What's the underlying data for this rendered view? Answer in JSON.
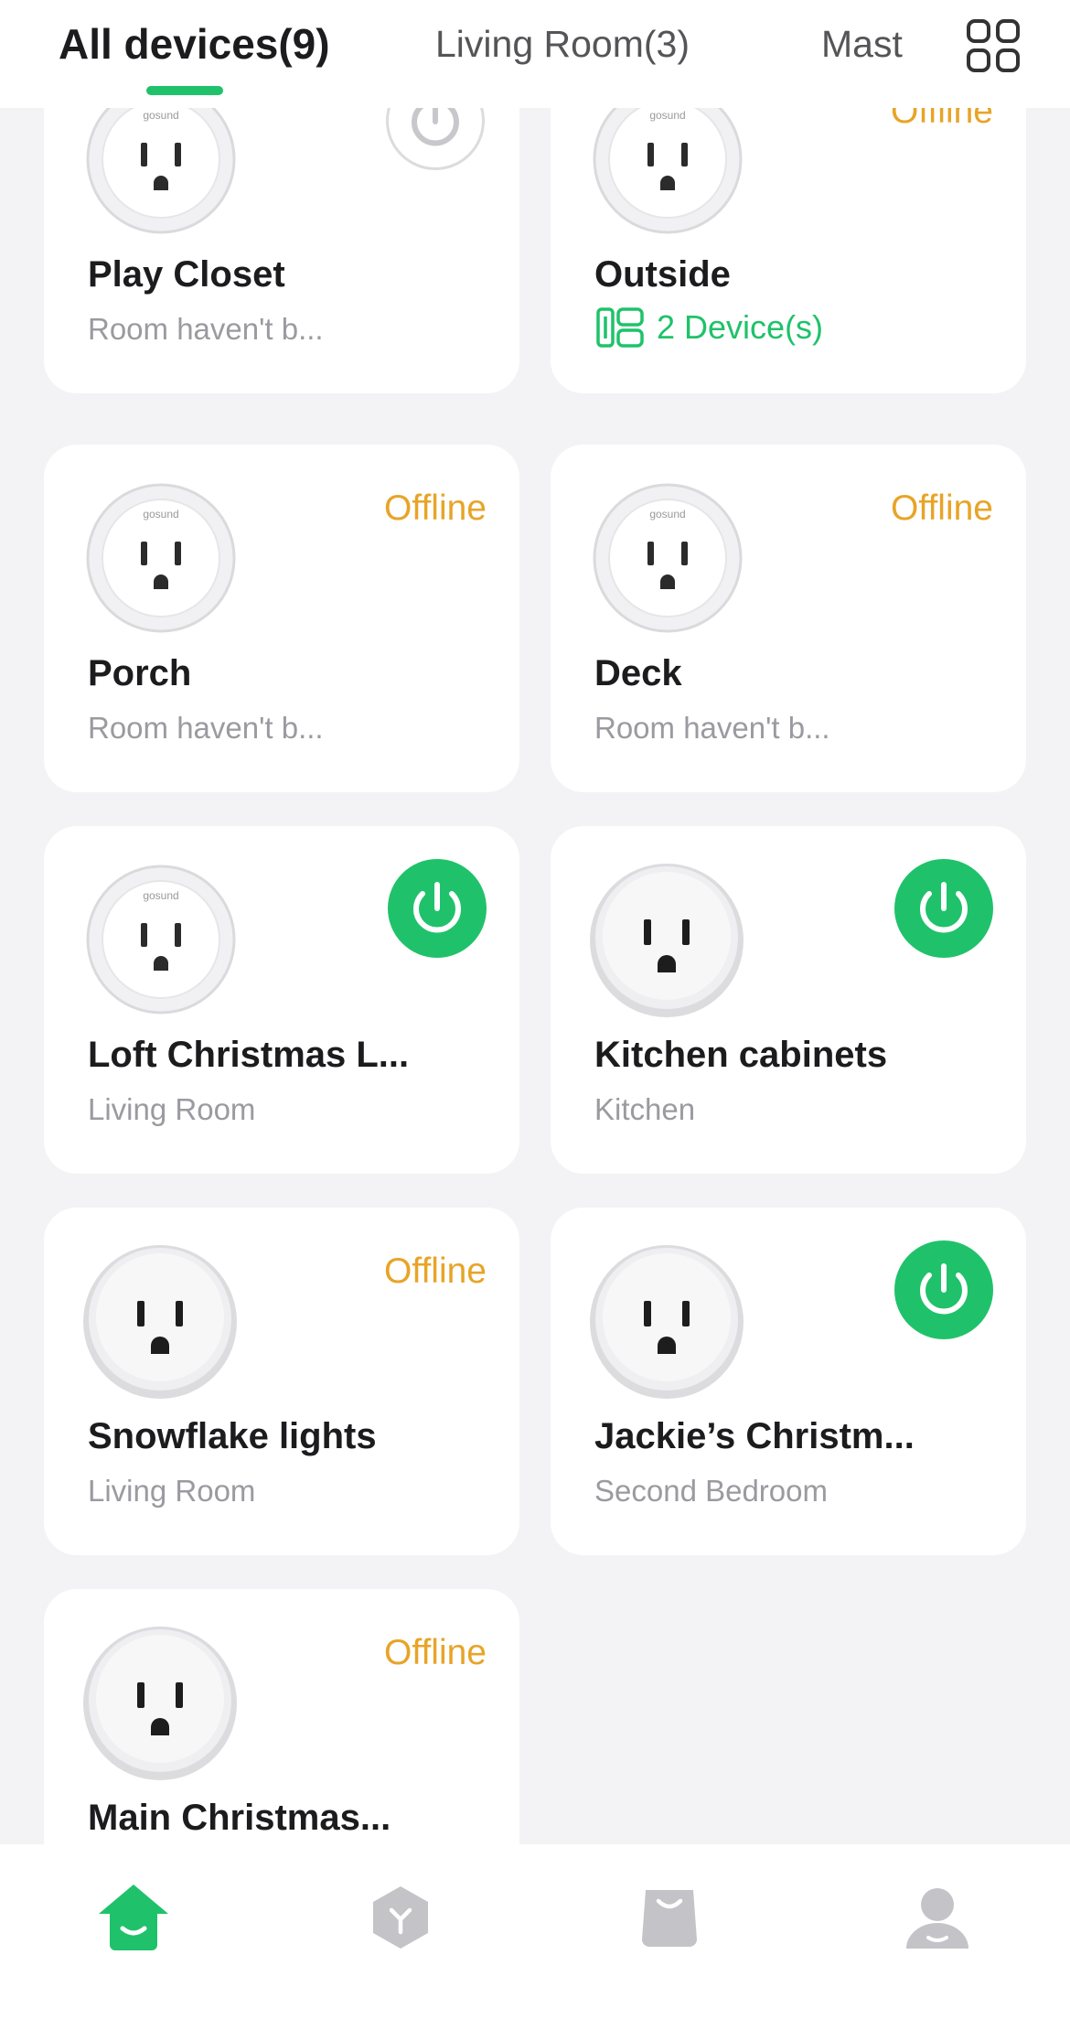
{
  "tabs": [
    {
      "label": "All devices(9)",
      "active": true
    },
    {
      "label": "Living Room(3)",
      "active": false
    },
    {
      "label": "Mast",
      "active": false
    }
  ],
  "colors": {
    "accent": "#1fc26a",
    "offline": "#e8a427",
    "card_bg": "#ffffff",
    "page_bg": "#f3f3f5",
    "subtitle": "#9a9aa0"
  },
  "devices": [
    {
      "name": "Play Closet",
      "subtitle": "Room haven't b...",
      "status": "power-off",
      "plug_icon": "gosund-plug-icon"
    },
    {
      "name": "Outside",
      "subtitle": "2 Device(s)",
      "status_text": "Offline",
      "status": "offline",
      "plug_icon": "gosund-plug-icon",
      "group_icon": "device-group-icon"
    },
    {
      "name": "Porch",
      "subtitle": "Room haven't b...",
      "status_text": "Offline",
      "status": "offline",
      "plug_icon": "gosund-plug-icon"
    },
    {
      "name": "Deck",
      "subtitle": "Room haven't b...",
      "status_text": "Offline",
      "status": "offline",
      "plug_icon": "gosund-plug-icon"
    },
    {
      "name": "Loft Christmas L...",
      "subtitle": "Living Room",
      "status": "power-on",
      "plug_icon": "gosund-plug-icon"
    },
    {
      "name": "Kitchen cabinets",
      "subtitle": "Kitchen",
      "status": "power-on",
      "plug_icon": "smart-plug-icon"
    },
    {
      "name": "Snowflake lights",
      "subtitle": "Living Room",
      "status_text": "Offline",
      "status": "offline",
      "plug_icon": "smart-plug-icon"
    },
    {
      "name": "Jackie’s Christm...",
      "subtitle": "Second Bedroom",
      "status": "power-on",
      "plug_icon": "smart-plug-icon"
    },
    {
      "name": "Main Christmas...",
      "subtitle": "",
      "status_text": "Offline",
      "status": "offline",
      "plug_icon": "smart-plug-icon"
    }
  ],
  "bottom_nav": [
    {
      "icon": "home-icon",
      "active": true
    },
    {
      "icon": "scene-icon",
      "active": false
    },
    {
      "icon": "shop-icon",
      "active": false
    },
    {
      "icon": "profile-icon",
      "active": false
    }
  ]
}
